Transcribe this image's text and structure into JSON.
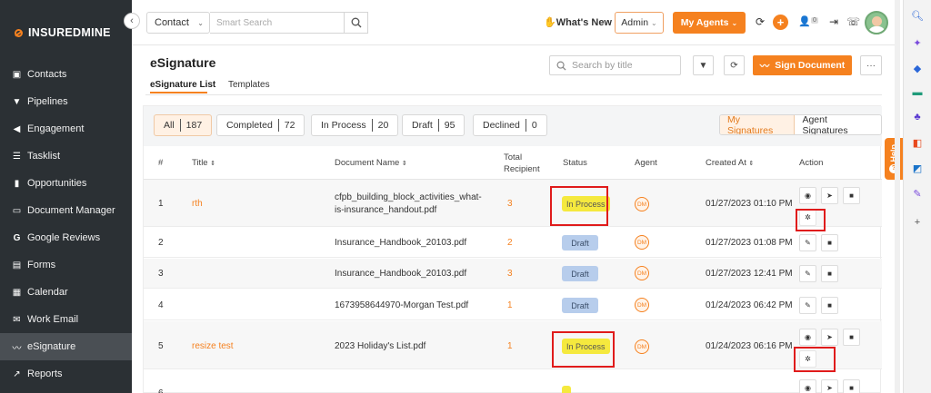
{
  "brand": {
    "name": "INSUREDMINE"
  },
  "sidebar": {
    "items": [
      {
        "label": "Contacts",
        "icon": "contacts-icon"
      },
      {
        "label": "Pipelines",
        "icon": "funnel-icon"
      },
      {
        "label": "Engagement",
        "icon": "megaphone-icon"
      },
      {
        "label": "Tasklist",
        "icon": "list-icon"
      },
      {
        "label": "Opportunities",
        "icon": "bar-chart-icon"
      },
      {
        "label": "Document Manager",
        "icon": "folder-icon"
      },
      {
        "label": "Google Reviews",
        "icon": "google-icon"
      },
      {
        "label": "Forms",
        "icon": "form-icon"
      },
      {
        "label": "Calendar",
        "icon": "calendar-icon"
      },
      {
        "label": "Work Email",
        "icon": "mail-icon"
      },
      {
        "label": "eSignature",
        "icon": "signature-icon",
        "active": true
      },
      {
        "label": "Reports",
        "icon": "line-chart-icon"
      }
    ]
  },
  "topbar": {
    "contact_select": "Contact",
    "search_placeholder": "Smart Search",
    "whats_new": "What's New",
    "admin_select": "Admin",
    "agents_button": "My Agents",
    "user_count": "0"
  },
  "page": {
    "title": "eSignature",
    "tabs": [
      "eSignature List",
      "Templates"
    ],
    "search_placeholder": "Search by title",
    "sign_button": "Sign Document"
  },
  "filters": [
    {
      "label": "All",
      "count": "187",
      "active": true
    },
    {
      "label": "Completed",
      "count": "72"
    },
    {
      "label": "In Process",
      "count": "20"
    },
    {
      "label": "Draft",
      "count": "95"
    },
    {
      "label": "Declined",
      "count": "0"
    }
  ],
  "signature_toggle": {
    "mine": "My Signatures",
    "agents": "Agent Signatures"
  },
  "table": {
    "headers": {
      "num": "#",
      "title": "Title",
      "document": "Document Name",
      "recipient_1": "Total",
      "recipient_2": "Recipient",
      "status": "Status",
      "agent": "Agent",
      "created": "Created At",
      "action": "Action"
    },
    "rows": [
      {
        "num": "1",
        "title": "rth",
        "doc_1": "cfpb_building_block_activities_what-",
        "doc_2": "is-insurance_handout.pdf",
        "recipients": "3",
        "status": "In Process",
        "agent": "DM",
        "created": "01/27/2023 01:10 PM"
      },
      {
        "num": "2",
        "title": "",
        "doc_1": "Insurance_Handbook_20103.pdf",
        "doc_2": "",
        "recipients": "2",
        "status": "Draft",
        "agent": "DM",
        "created": "01/27/2023 01:08 PM"
      },
      {
        "num": "3",
        "title": "",
        "doc_1": "Insurance_Handbook_20103.pdf",
        "doc_2": "",
        "recipients": "3",
        "status": "Draft",
        "agent": "DM",
        "created": "01/27/2023 12:41 PM"
      },
      {
        "num": "4",
        "title": "",
        "doc_1": "1673958644970-Morgan Test.pdf",
        "doc_2": "",
        "recipients": "1",
        "status": "Draft",
        "agent": "DM",
        "created": "01/24/2023 06:42 PM"
      },
      {
        "num": "5",
        "title": "resize test",
        "doc_1": "2023 Holiday's List.pdf",
        "doc_2": "",
        "recipients": "1",
        "status": "In Process",
        "agent": "DM",
        "created": "01/24/2023 06:16 PM"
      }
    ]
  },
  "help": {
    "label": "Help"
  }
}
